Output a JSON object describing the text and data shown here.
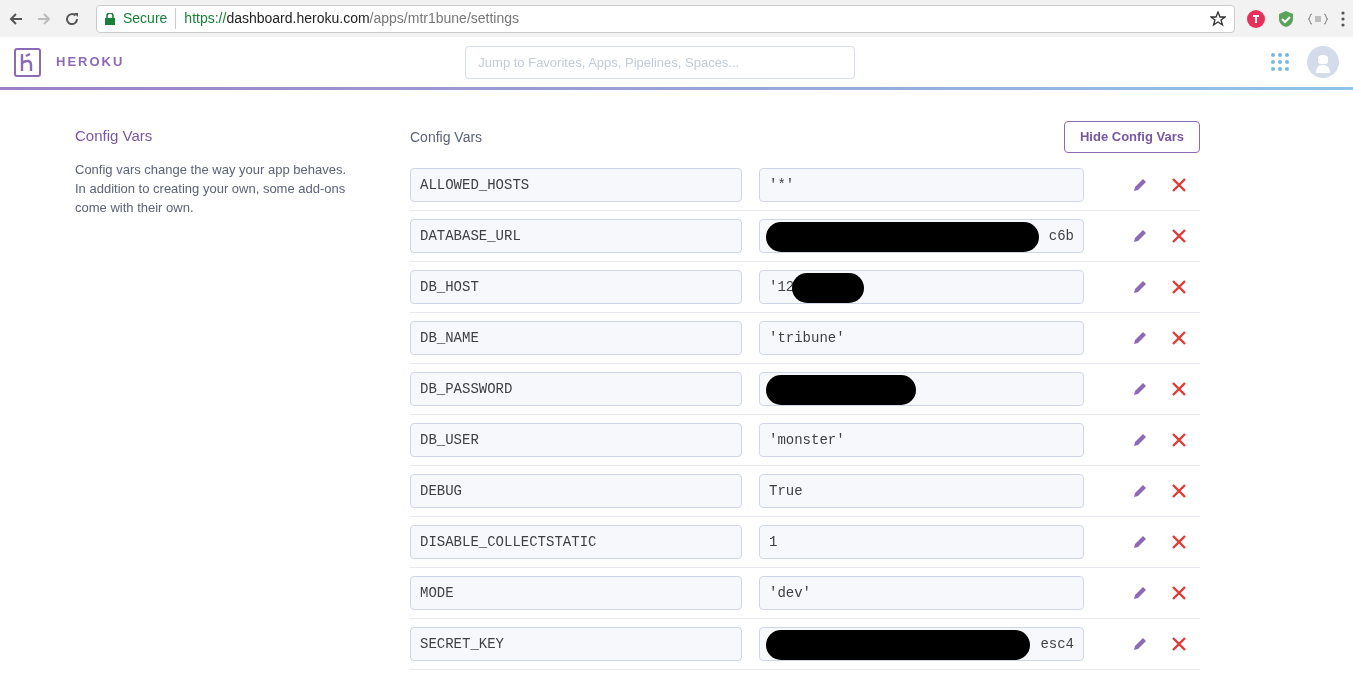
{
  "browser": {
    "secure_label": "Secure",
    "url_scheme": "https://",
    "url_host": "dashboard.heroku.com",
    "url_path": "/apps/mtr1bune/settings"
  },
  "header": {
    "brand": "HEROKU",
    "search": {
      "placeholder": "Jump to Favorites, Apps, Pipelines, Spaces..."
    }
  },
  "section": {
    "title": "Config Vars",
    "description": "Config vars change the way your app behaves. In addition to creating your own, some add-ons come with their own."
  },
  "config_vars": {
    "title": "Config Vars",
    "toggle_button": "Hide Config Vars",
    "rows": [
      {
        "key": "ALLOWED_HOSTS",
        "value": "'*'",
        "redacted": false
      },
      {
        "key": "DATABASE_URL",
        "value": "c6b",
        "redacted": true
      },
      {
        "key": "DB_HOST",
        "value": "'12",
        "redacted": true
      },
      {
        "key": "DB_NAME",
        "value": "'tribune'",
        "redacted": false
      },
      {
        "key": "DB_PASSWORD",
        "redacted": true
      },
      {
        "key": "DB_USER",
        "value": "'monster'",
        "redacted": false
      },
      {
        "key": "DEBUG",
        "value": "True",
        "redacted": false
      },
      {
        "key": "DISABLE_COLLECTSTATIC",
        "value": "1",
        "redacted": false
      },
      {
        "key": "MODE",
        "value": "'dev'",
        "redacted": false
      },
      {
        "key": "SECRET_KEY",
        "value": "esc4",
        "redacted": true
      }
    ]
  }
}
